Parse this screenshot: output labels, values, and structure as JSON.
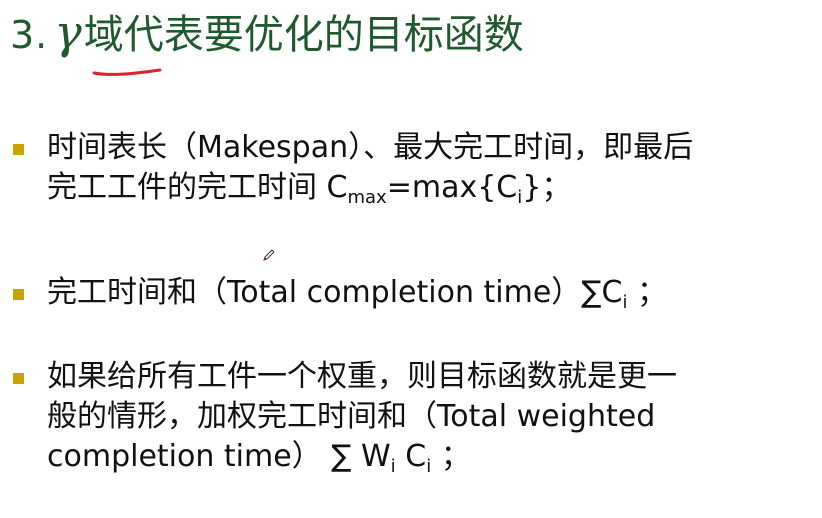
{
  "title": {
    "number": "3.",
    "gamma": "γ",
    "text": "域代表要优化的目标函数",
    "color": "#1f5a2e"
  },
  "bullets": [
    {
      "line1": "时间表长（Makespan）、最大完工时间，即最后",
      "line2_text": "完工工件的完工时间 C",
      "line2_sub_max": "max",
      "line2_mid": "=max{C",
      "line2_sub_i": "i",
      "line2_end": "}；"
    },
    {
      "text": "完工时间和（Total completion time）",
      "sum": "∑",
      "c": "C",
      "sub_i": "i",
      "end": " ；"
    },
    {
      "line1": "如果给所有工件一个权重，则目标函数就是更一",
      "line2": "般的情形，加权完工时间和（Total weighted",
      "line3_text": "completion time）",
      "sum": "∑",
      "w": "W",
      "sub_w": "i",
      "c": "C",
      "sub_c": "i",
      "end": "；"
    }
  ],
  "colors": {
    "bullet": "#c9a400",
    "underline": "#e0202a",
    "text": "#111111"
  },
  "icons": {
    "cursor": "pencil-cursor-icon"
  }
}
